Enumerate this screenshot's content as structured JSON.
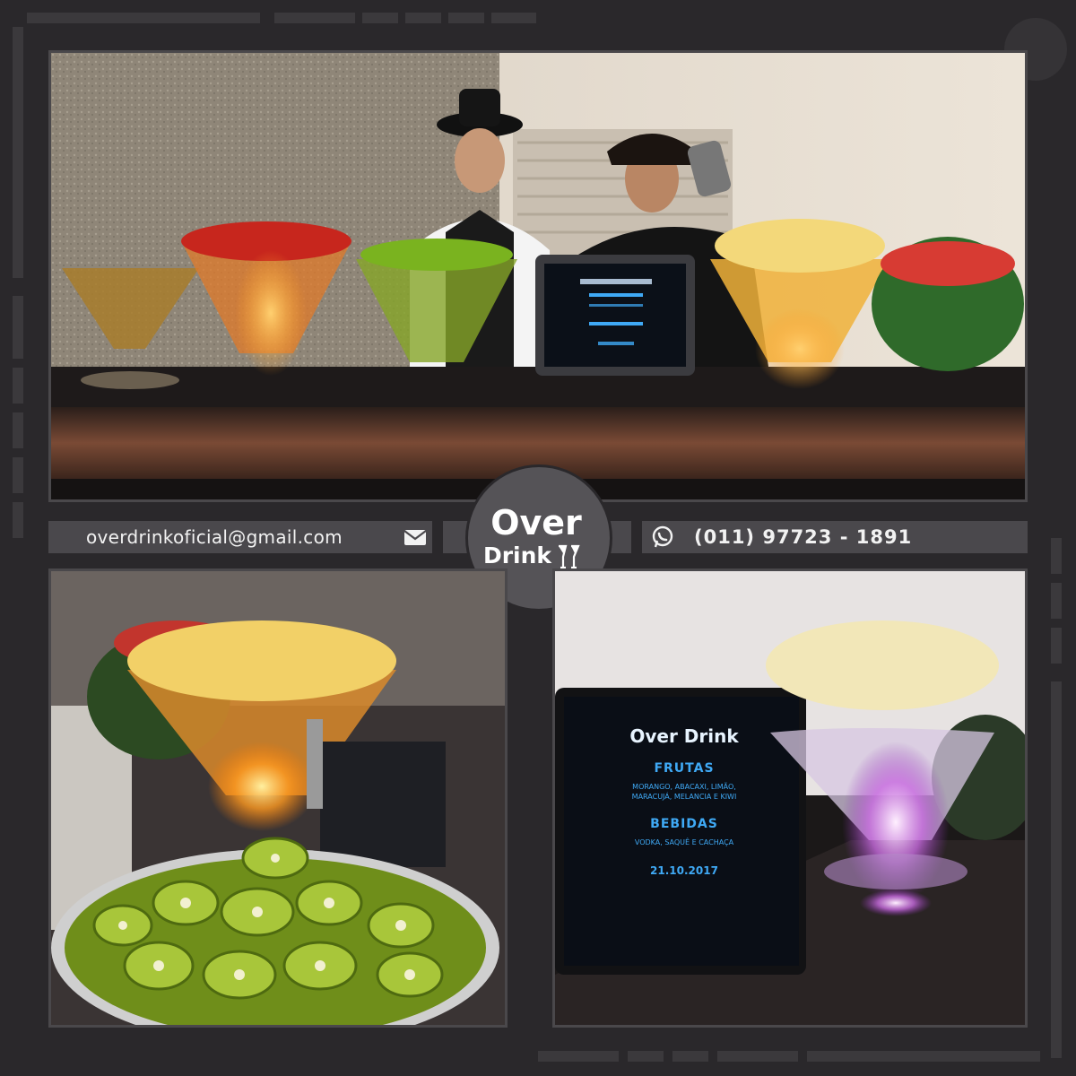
{
  "logo": {
    "line1": "Over",
    "line2": "Drink"
  },
  "contact": {
    "email": "overdrinkoficial@gmail.com",
    "email_icon": "envelope-icon",
    "phone": "(011) 97723 - 1891",
    "phone_icon": "whatsapp-icon"
  },
  "screen_menu": {
    "brand": "Over Drink",
    "section1_title": "FRUTAS",
    "section1_line1": "MORANGO, ABACAXI, LIMÃO,",
    "section1_line2": "MARACUJÁ, MELANCIA E KIWI",
    "section2_title": "BEBIDAS",
    "section2_line1": "VODKA, SAQUÊ E CACHAÇA",
    "date": "21.10.2017"
  },
  "colors": {
    "background": "#2a282b",
    "bar": "#4a484c",
    "logo_circle": "#555357",
    "screen_text": "#3fa9f5"
  }
}
